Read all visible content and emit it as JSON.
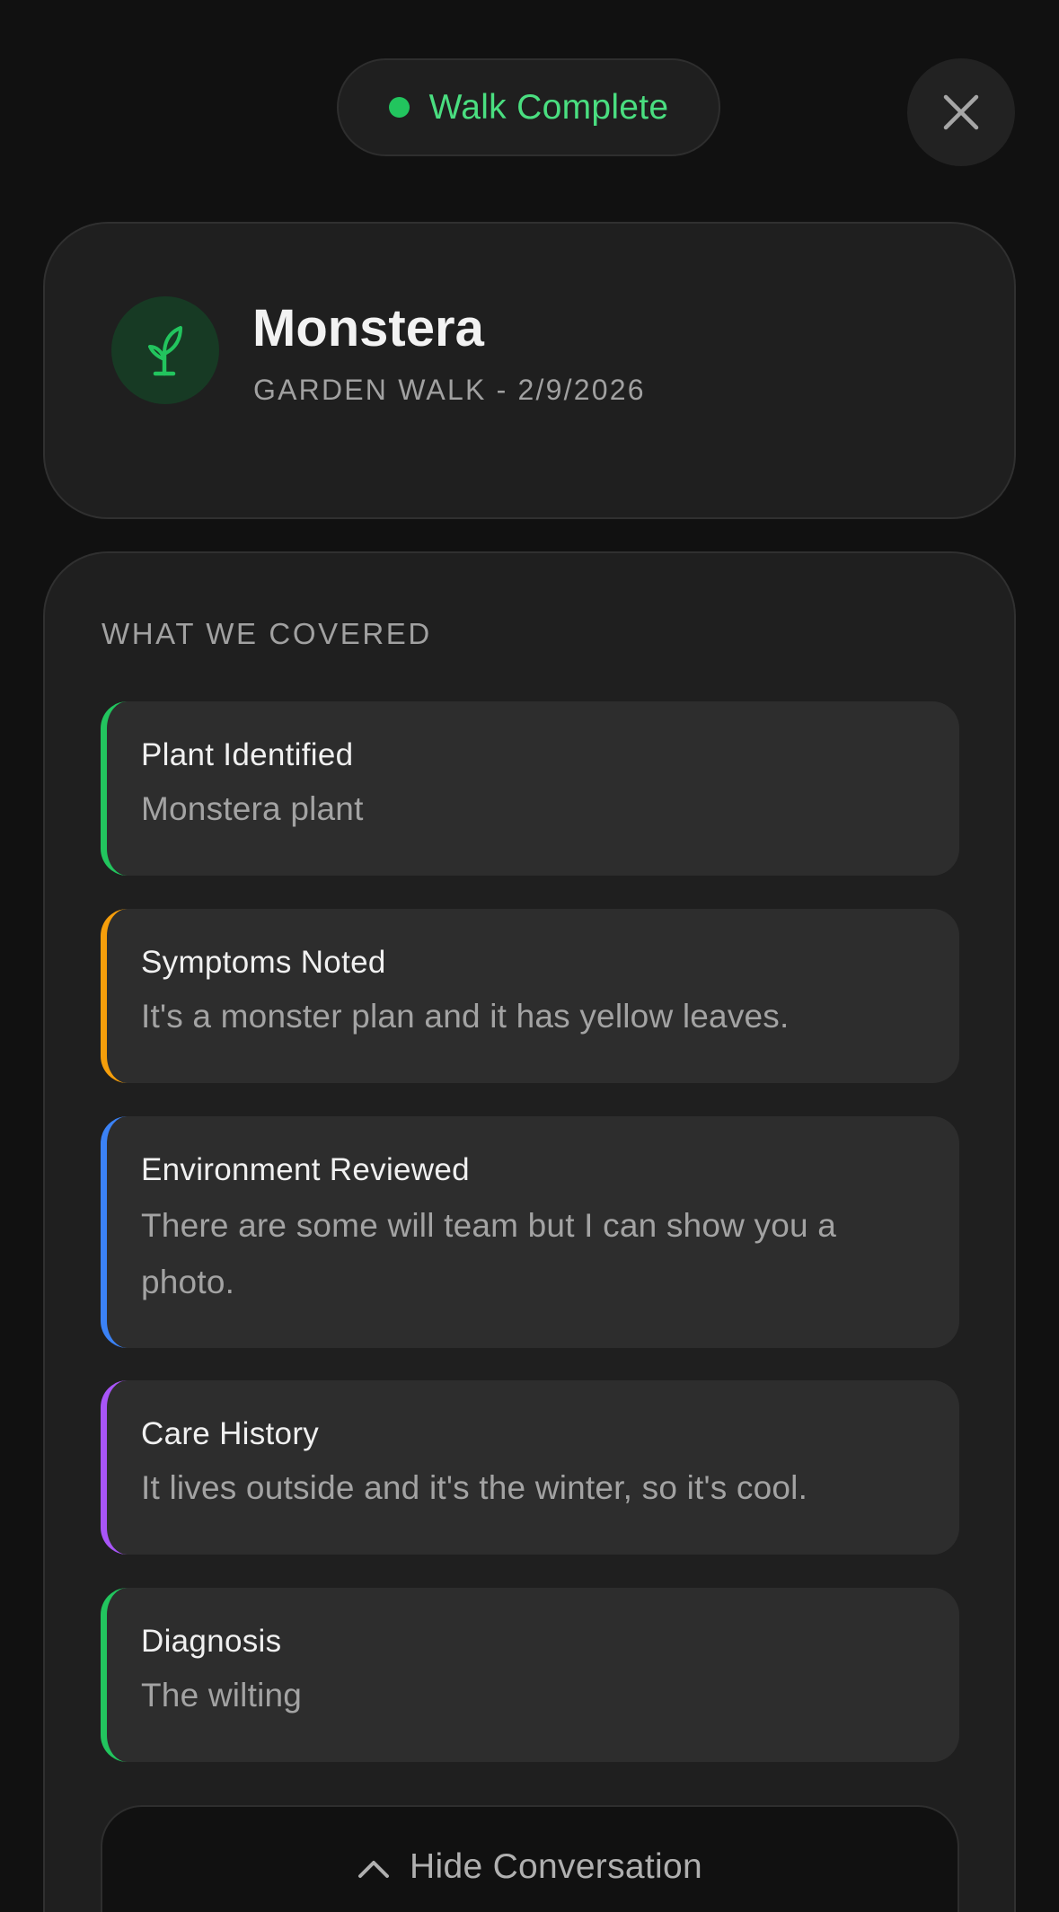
{
  "header": {
    "status_label": "Walk Complete",
    "status_color": "#22c55e",
    "close_icon": "close-icon"
  },
  "plant": {
    "name": "Monstera",
    "subtitle": "GARDEN WALK - 2/9/2026",
    "icon": "sprout-icon",
    "accent": "#22c55e"
  },
  "covered": {
    "heading": "WHAT WE COVERED",
    "items": [
      {
        "title": "Plant Identified",
        "body": "Monstera plant",
        "accent": "#22c55e"
      },
      {
        "title": "Symptoms Noted",
        "body": "It's a monster plan and it has yellow leaves.",
        "accent": "#f59e0b"
      },
      {
        "title": "Environment Reviewed",
        "body": "There are some will team but I can show you a photo.",
        "accent": "#3b82f6"
      },
      {
        "title": "Care History",
        "body": "It lives outside and it's the winter, so it's cool.",
        "accent": "#a855f7"
      },
      {
        "title": "Diagnosis",
        "body": "The wilting",
        "accent": "#22c55e"
      }
    ]
  },
  "footer": {
    "toggle_label": "Hide Conversation",
    "toggle_icon": "chevron-up-icon"
  }
}
